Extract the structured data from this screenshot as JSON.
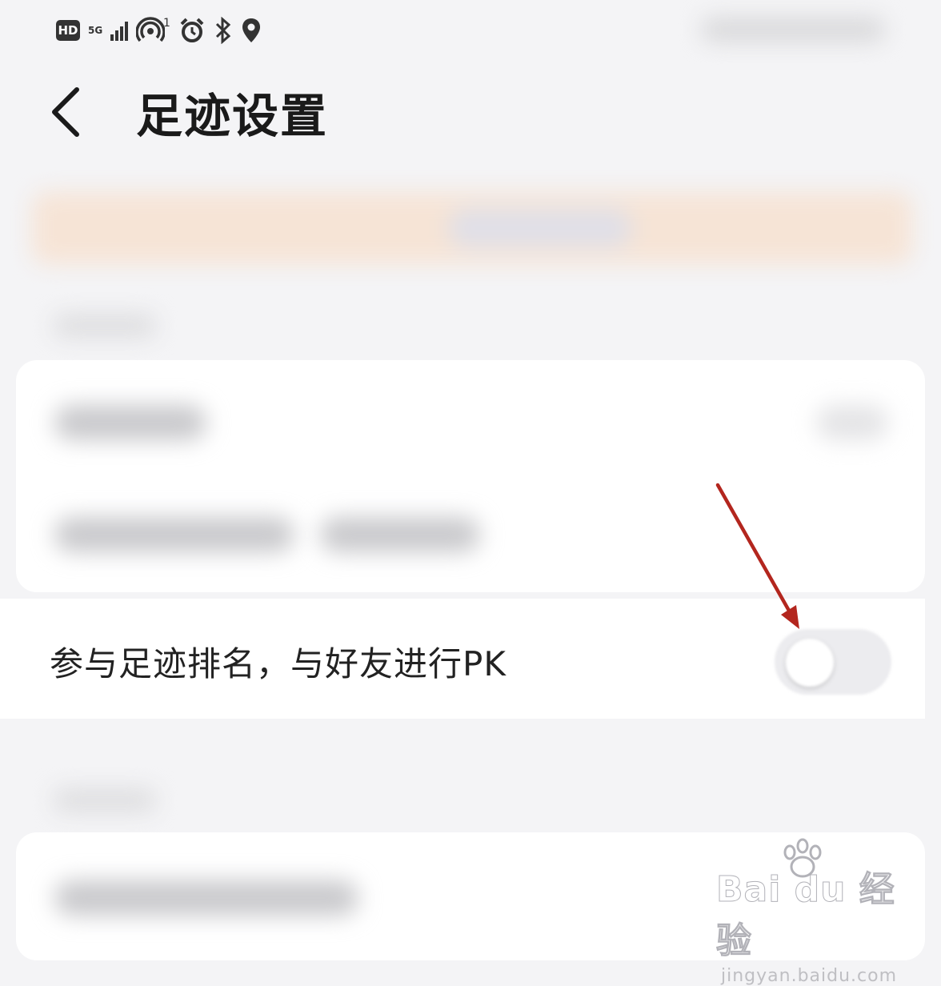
{
  "status_bar": {
    "hd_badge": "HD",
    "network_label": "5G",
    "hotspot_count": "1",
    "icons": [
      "hd-icon",
      "signal-icon",
      "hotspot-icon",
      "alarm-icon",
      "bluetooth-icon",
      "location-icon"
    ]
  },
  "header": {
    "back_icon": "chevron-left-icon",
    "title": "足迹设置"
  },
  "settings": {
    "pk_row": {
      "label": "参与足迹排名，与好友进行PK",
      "toggle_on": false
    }
  },
  "annotation": {
    "arrow_color": "#b3261e"
  },
  "watermark": {
    "logo": "Bai du 经验",
    "url": "jingyan.baidu.com"
  },
  "colors": {
    "background": "#f4f4f6",
    "card": "#ffffff",
    "banner": "#f6e4d6",
    "text_primary": "#1a1a1a"
  }
}
